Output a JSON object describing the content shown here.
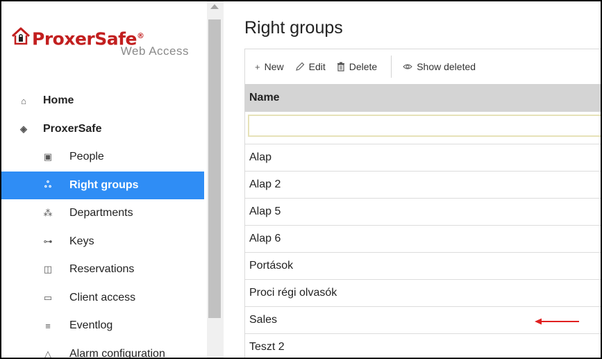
{
  "logo": {
    "brand": "ProxerSafe",
    "reg": "®",
    "subtitle": "Web Access"
  },
  "nav": {
    "items": [
      {
        "label": "Home",
        "icon": "home-icon",
        "glyph": "⌂",
        "level": "top",
        "active": false
      },
      {
        "label": "ProxerSafe",
        "icon": "layers-icon",
        "glyph": "◈",
        "level": "top",
        "active": false
      },
      {
        "label": "People",
        "icon": "id-card-icon",
        "glyph": "▣",
        "level": "sub",
        "active": false
      },
      {
        "label": "Right groups",
        "icon": "group-icon",
        "glyph": "ஃ",
        "level": "sub",
        "active": true
      },
      {
        "label": "Departments",
        "icon": "hierarchy-icon",
        "glyph": "⁂",
        "level": "sub",
        "active": false
      },
      {
        "label": "Keys",
        "icon": "key-icon",
        "glyph": "⊶",
        "level": "sub",
        "active": false
      },
      {
        "label": "Reservations",
        "icon": "book-icon",
        "glyph": "◫",
        "level": "sub",
        "active": false
      },
      {
        "label": "Client access",
        "icon": "keyboard-icon",
        "glyph": "▭",
        "level": "sub",
        "active": false
      },
      {
        "label": "Eventlog",
        "icon": "list-icon",
        "glyph": "≡",
        "level": "sub",
        "active": false
      },
      {
        "label": "Alarm configuration",
        "icon": "bell-icon",
        "glyph": "△",
        "level": "sub",
        "active": false
      }
    ]
  },
  "main": {
    "title": "Right groups",
    "toolbar": {
      "new_label": "New",
      "edit_label": "Edit",
      "delete_label": "Delete",
      "show_deleted_label": "Show deleted"
    },
    "table": {
      "column_header": "Name",
      "filter_value": "",
      "rows": [
        "Alap",
        "Alap 2",
        "Alap 5",
        "Alap 6",
        "Portások",
        "Proci régi olvasók",
        "Sales",
        "Teszt 2"
      ]
    }
  },
  "colors": {
    "brand": "#c21f1f",
    "active": "#2f8df5",
    "header_bg": "#d4d4d4",
    "arrow": "#e02020"
  }
}
